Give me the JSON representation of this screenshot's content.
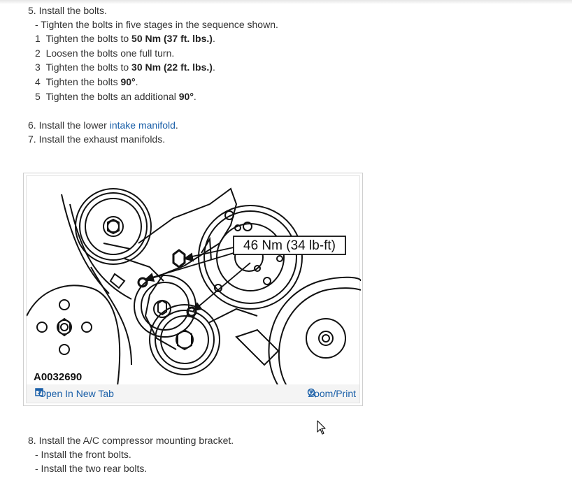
{
  "steps": {
    "step5": {
      "title": "5. Install the bolts.",
      "intro": "-  Tighten the bolts in five stages in the sequence shown.",
      "stages": [
        {
          "num": "1",
          "pre": "Tighten the bolts to ",
          "bold": "50 Nm (37 ft. lbs.)",
          "post": "."
        },
        {
          "num": "2",
          "pre": "Loosen the bolts one full turn.",
          "bold": "",
          "post": ""
        },
        {
          "num": "3",
          "pre": "Tighten the bolts to ",
          "bold": "30 Nm (22 ft. lbs.)",
          "post": "."
        },
        {
          "num": "4",
          "pre": "Tighten the bolts ",
          "bold": "90°",
          "post": "."
        },
        {
          "num": "5",
          "pre": "Tighten the bolts an additional ",
          "bold": "90°",
          "post": "."
        }
      ]
    },
    "step6": {
      "pre": "6. Install the lower ",
      "link": "intake manifold",
      "post": "."
    },
    "step7": "7. Install the exhaust manifolds.",
    "step8": {
      "title": "8. Install the A/C compressor mounting bracket.",
      "subs": [
        "-  Install the front bolts.",
        "-  Install the two rear bolts."
      ]
    }
  },
  "figure": {
    "torque_label": "46 Nm (34 lb-ft)",
    "figure_id": "A0032690",
    "open_label": "Open In New Tab",
    "zoom_label": "Zoom/Print",
    "open_icon": "new-tab-icon",
    "zoom_icon": "zoom-in-icon"
  },
  "colors": {
    "link": "#1a5fa8",
    "text": "#333333"
  }
}
